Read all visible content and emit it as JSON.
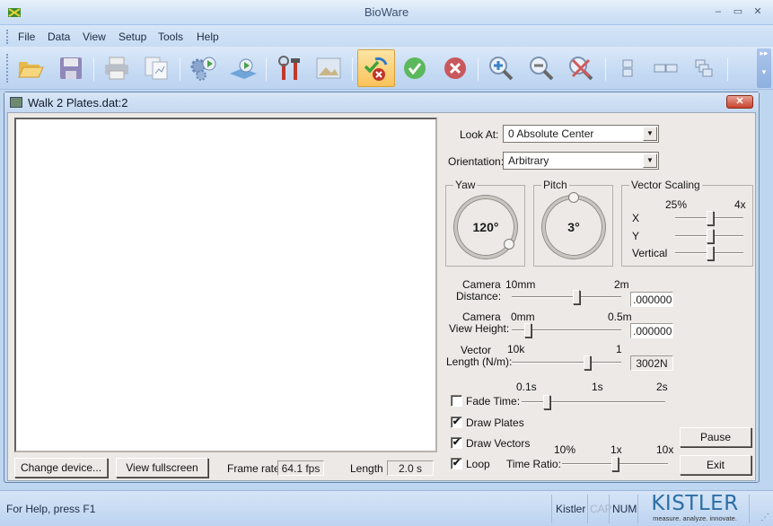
{
  "window": {
    "title": "BioWare",
    "controls": {
      "minimize": "–",
      "maximize": "▭",
      "close": "✕"
    }
  },
  "menu": {
    "items": [
      "File",
      "Data",
      "View",
      "Setup",
      "Tools",
      "Help"
    ]
  },
  "toolbar": {
    "buttons": [
      {
        "name": "open-folder",
        "icon": "folder-open-icon"
      },
      {
        "name": "save",
        "icon": "floppy-disk-icon"
      },
      {
        "name": "print",
        "icon": "printer-icon"
      },
      {
        "name": "print-preview",
        "icon": "print-preview-icon"
      },
      {
        "name": "start-acquisition",
        "icon": "gears-play-icon"
      },
      {
        "name": "playback",
        "icon": "plate-play-icon"
      },
      {
        "name": "tools",
        "icon": "wrench-hammer-icon"
      },
      {
        "name": "image",
        "icon": "picture-icon"
      },
      {
        "name": "validate",
        "icon": "check-cross-sync-icon",
        "active": true
      },
      {
        "name": "accept",
        "icon": "green-check-icon"
      },
      {
        "name": "reject",
        "icon": "red-x-icon"
      },
      {
        "name": "zoom-in",
        "icon": "zoom-in-icon"
      },
      {
        "name": "zoom-out",
        "icon": "zoom-out-icon"
      },
      {
        "name": "zoom-reset",
        "icon": "zoom-cancel-icon"
      },
      {
        "name": "tile-horizontal",
        "icon": "tile-horizontal-icon"
      },
      {
        "name": "tile-vertical",
        "icon": "tile-vertical-icon"
      },
      {
        "name": "cascade",
        "icon": "cascade-icon"
      }
    ]
  },
  "document": {
    "title": "Walk 2 Plates.dat:2",
    "close": "✕",
    "buttons": {
      "change_device": "Change device...",
      "view_fullscreen": "View fullscreen",
      "pause": "Pause",
      "exit": "Exit"
    },
    "frame_rate": {
      "label": "Frame rate",
      "value": "64.1 fps"
    },
    "length": {
      "label": "Length",
      "value": "2.0 s"
    },
    "look_at": {
      "label": "Look At:",
      "value": "0 Absolute Center"
    },
    "orientation": {
      "label": "Orientation:",
      "value": "Arbitrary"
    },
    "yaw": {
      "label": "Yaw",
      "value": "120°"
    },
    "pitch": {
      "label": "Pitch",
      "value": "3°"
    },
    "vector_scaling": {
      "label": "Vector Scaling",
      "min_label": "25%",
      "max_label": "4x",
      "rows": [
        {
          "label": "X",
          "fraction": 0.52
        },
        {
          "label": "Y",
          "fraction": 0.52
        },
        {
          "label": "Vertical",
          "fraction": 0.52
        }
      ]
    },
    "camera_distance": {
      "label1": "Camera",
      "label2": "Distance:",
      "min": "10mm",
      "max": "2m",
      "fraction": 0.6,
      "value": ".000000"
    },
    "camera_view_height": {
      "label1": "Camera",
      "label2": "View Height:",
      "min": "0mm",
      "max": "0.5m",
      "fraction": 0.12,
      "value": ".000000 r"
    },
    "vector_length": {
      "label1": "Vector",
      "label2": "Length (N/m):",
      "min": "10k",
      "max": "1",
      "fraction": 0.7,
      "value": "3002N"
    },
    "fade_time": {
      "label": "Fade Time:",
      "checked": false,
      "ticks": [
        "0.1s",
        "1s",
        "2s"
      ],
      "fraction": 0.16
    },
    "draw_plates": {
      "label": "Draw Plates",
      "checked": true
    },
    "draw_vectors": {
      "label": "Draw Vectors",
      "checked": true
    },
    "loop": {
      "label": "Loop",
      "checked": true
    },
    "time_ratio": {
      "label": "Time Ratio:",
      "ticks": [
        "10%",
        "1x",
        "10x"
      ],
      "fraction": 0.5
    }
  },
  "status": {
    "help": "For Help, press F1",
    "panes": {
      "user": "Kistler",
      "cap": "CAP",
      "num": "NUM"
    },
    "logo": {
      "main": "KISTLER",
      "tagline": "measure. analyze. innovate."
    }
  },
  "colors": {
    "accent": "#2c6fa6",
    "active_button": "#f9c25a",
    "close_red": "#c8432e"
  }
}
